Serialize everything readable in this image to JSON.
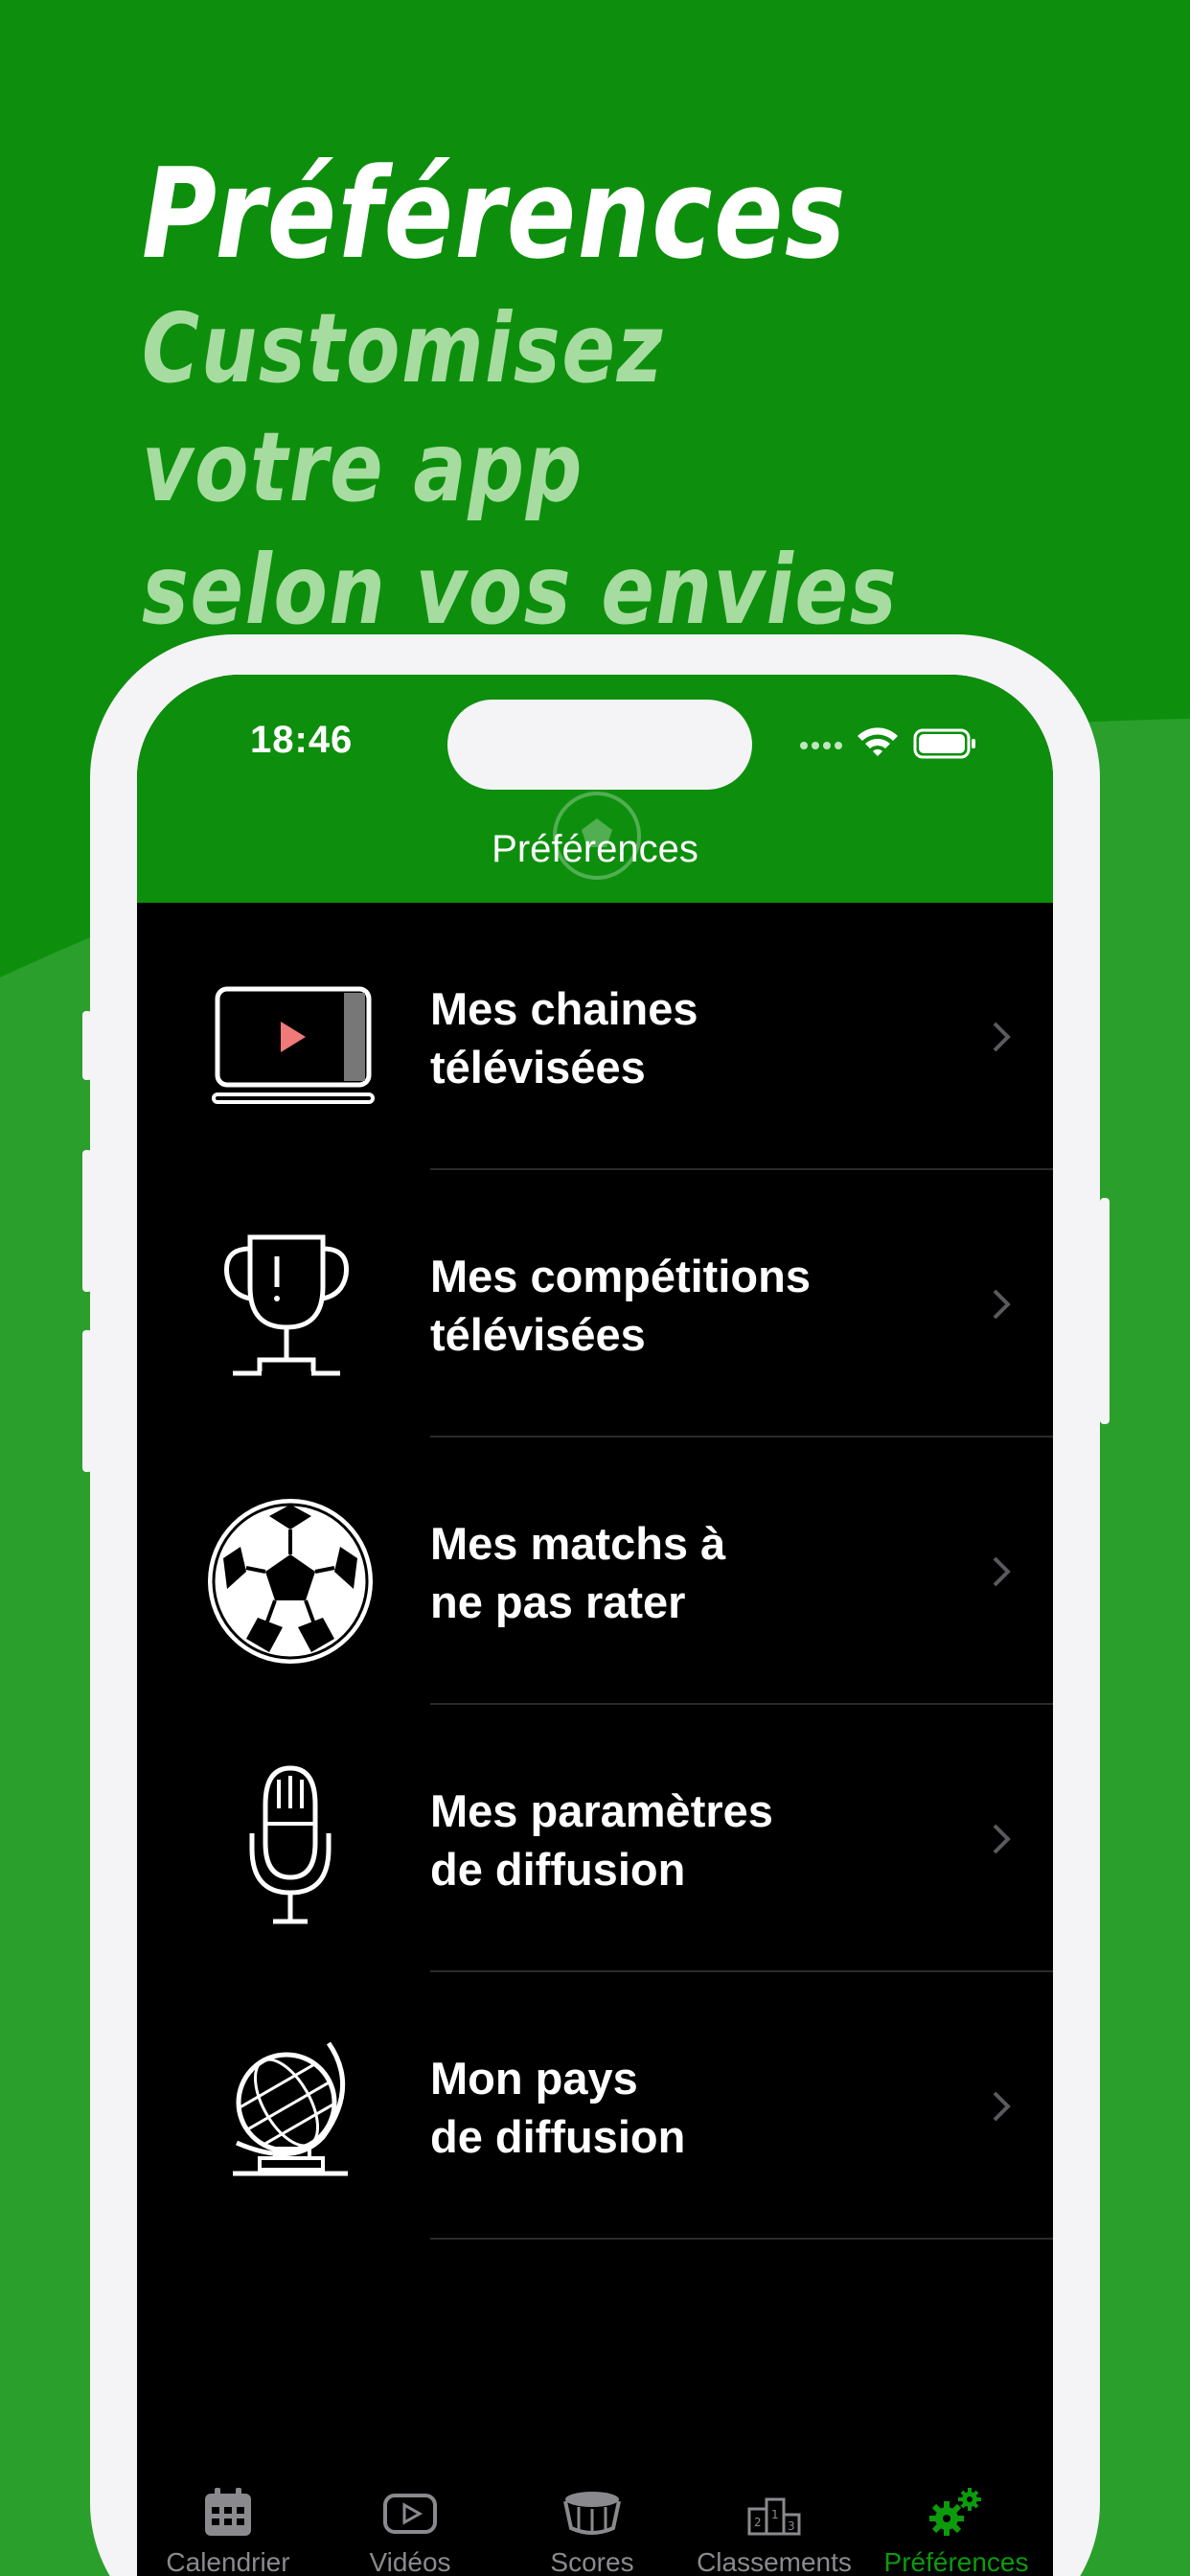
{
  "headline": {
    "title": "Préférences",
    "subtitle_line1": "Customisez votre app",
    "subtitle_line2": "selon vos envies"
  },
  "status_bar": {
    "time": "18:46"
  },
  "nav": {
    "title": "Préférences"
  },
  "menu": [
    {
      "line1": "Mes chaines",
      "line2": "télévisées",
      "icon": "tv-icon"
    },
    {
      "line1": "Mes compétitions",
      "line2": "télévisées",
      "icon": "trophy-icon"
    },
    {
      "line1": "Mes matchs à",
      "line2": "ne pas rater",
      "icon": "soccer-ball-icon"
    },
    {
      "line1": "Mes paramètres",
      "line2": "de diffusion",
      "icon": "microphone-icon"
    },
    {
      "line1": "Mon pays",
      "line2": "de diffusion",
      "icon": "globe-icon"
    }
  ],
  "tabs": [
    {
      "label": "Calendrier",
      "icon": "calendar-icon",
      "active": false
    },
    {
      "label": "Vidéos",
      "icon": "play-icon",
      "active": false
    },
    {
      "label": "Scores",
      "icon": "stadium-icon",
      "active": false
    },
    {
      "label": "Classements",
      "icon": "podium-icon",
      "active": false
    },
    {
      "label": "Préférences",
      "icon": "gears-icon",
      "active": true
    }
  ],
  "colors": {
    "brand_green": "#0d8f0d",
    "light_green_text": "#a6dca0",
    "tab_active": "#0d9a0d",
    "tab_inactive": "#8a8a8e",
    "tv_play": "#f07a7a"
  }
}
